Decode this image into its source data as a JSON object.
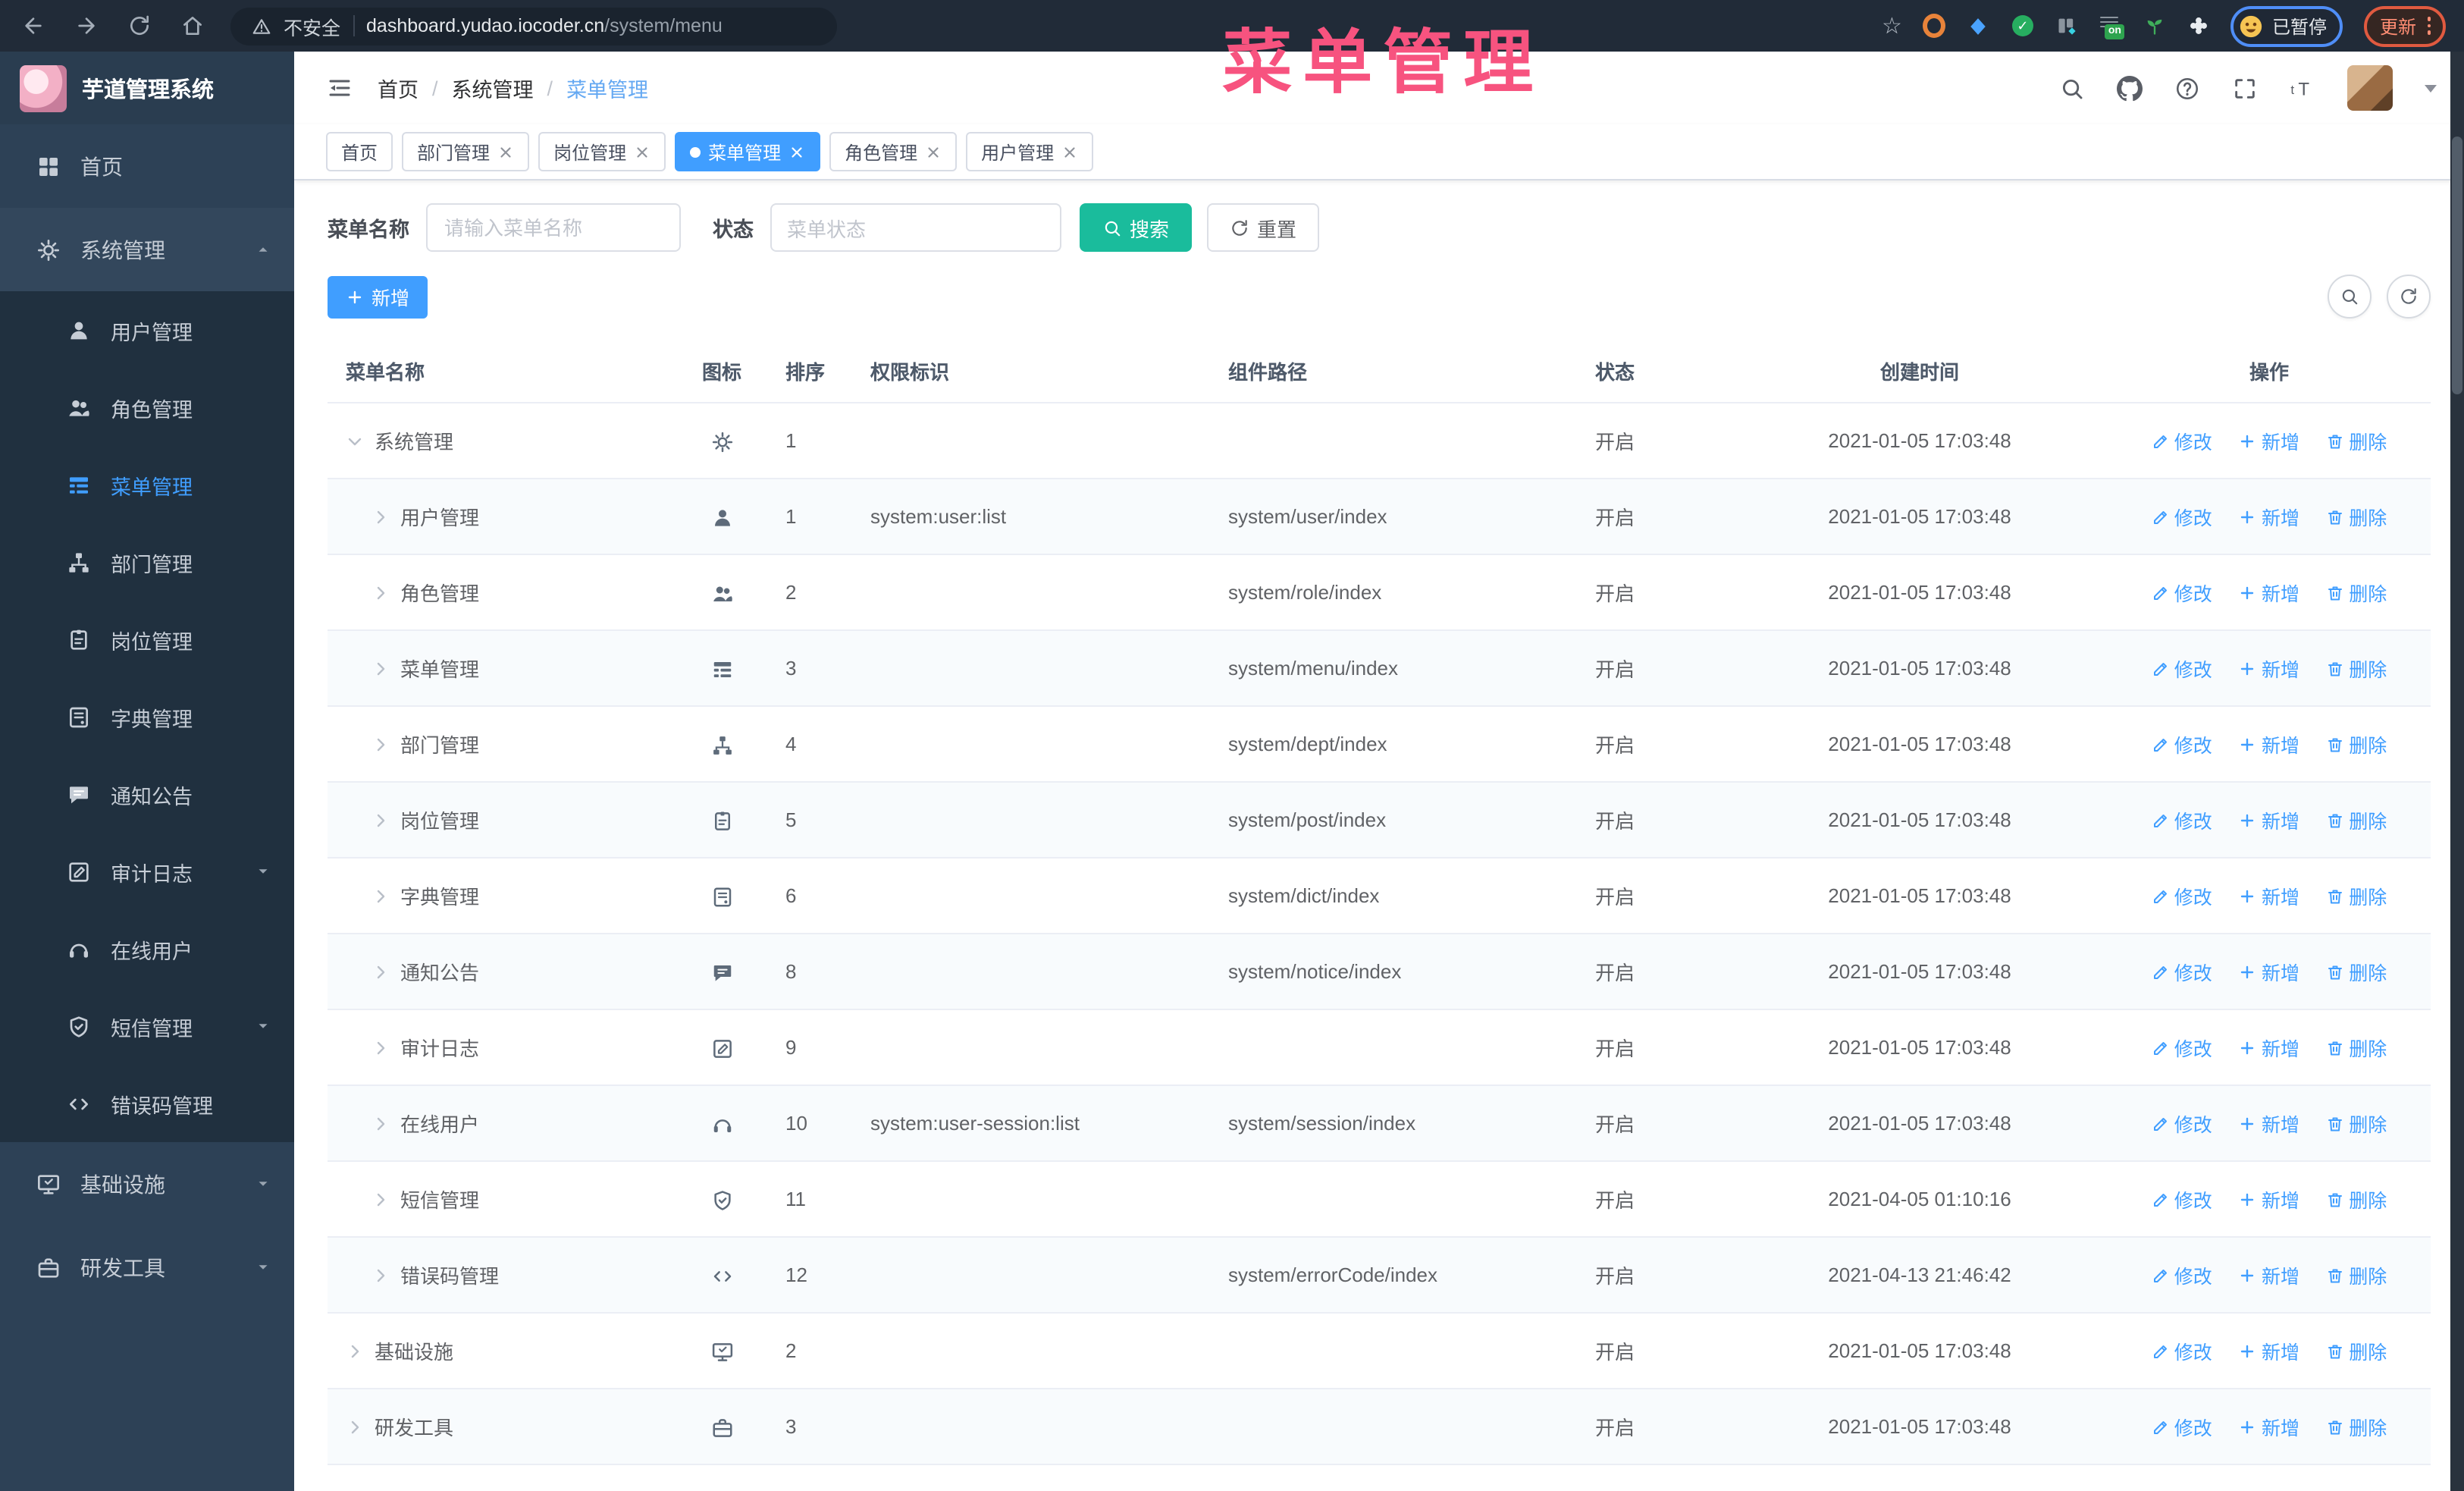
{
  "browser": {
    "security_label": "不安全",
    "url_host": "dashboard.yudao.iocoder.cn",
    "url_path": "/system/menu",
    "ext_on": "on",
    "paused_label": "已暂停",
    "update_label": "更新"
  },
  "overlay_title": "菜单管理",
  "sidebar": {
    "app_title": "芋道管理系统",
    "items": [
      {
        "label": "首页",
        "icon": "dashboard"
      },
      {
        "label": "系统管理",
        "icon": "gear",
        "expanded": true,
        "children": [
          {
            "label": "用户管理",
            "icon": "user"
          },
          {
            "label": "角色管理",
            "icon": "users"
          },
          {
            "label": "菜单管理",
            "icon": "menu",
            "active": true
          },
          {
            "label": "部门管理",
            "icon": "tree"
          },
          {
            "label": "岗位管理",
            "icon": "badge"
          },
          {
            "label": "字典管理",
            "icon": "book"
          },
          {
            "label": "通知公告",
            "icon": "chat"
          },
          {
            "label": "审计日志",
            "icon": "editlog",
            "arrow": "down"
          },
          {
            "label": "在线用户",
            "icon": "headset"
          },
          {
            "label": "短信管理",
            "icon": "shield",
            "arrow": "down"
          },
          {
            "label": "错误码管理",
            "icon": "code"
          }
        ]
      },
      {
        "label": "基础设施",
        "icon": "monitor",
        "arrow": "down"
      },
      {
        "label": "研发工具",
        "icon": "toolbox",
        "arrow": "down"
      }
    ]
  },
  "header": {
    "breadcrumb": [
      "首页",
      "系统管理",
      "菜单管理"
    ]
  },
  "tags": [
    {
      "label": "首页",
      "closable": false,
      "active": false
    },
    {
      "label": "部门管理",
      "closable": true,
      "active": false
    },
    {
      "label": "岗位管理",
      "closable": true,
      "active": false
    },
    {
      "label": "菜单管理",
      "closable": true,
      "active": true
    },
    {
      "label": "角色管理",
      "closable": true,
      "active": false
    },
    {
      "label": "用户管理",
      "closable": true,
      "active": false
    }
  ],
  "filters": {
    "name_label": "菜单名称",
    "name_placeholder": "请输入菜单名称",
    "status_label": "状态",
    "status_placeholder": "菜单状态",
    "search_label": "搜索",
    "reset_label": "重置"
  },
  "toolbar": {
    "add_label": "新增"
  },
  "table": {
    "columns": [
      "菜单名称",
      "图标",
      "排序",
      "权限标识",
      "组件路径",
      "状态",
      "创建时间",
      "操作"
    ],
    "actions": {
      "edit": "修改",
      "add": "新增",
      "del": "删除"
    },
    "rows": [
      {
        "name": "系统管理",
        "icon": "gear",
        "level": 0,
        "caret": "down",
        "sort": "1",
        "perm": "",
        "path": "",
        "status": "开启",
        "time": "2021-01-05 17:03:48"
      },
      {
        "name": "用户管理",
        "icon": "user",
        "level": 1,
        "caret": "right",
        "sort": "1",
        "perm": "system:user:list",
        "path": "system/user/index",
        "status": "开启",
        "time": "2021-01-05 17:03:48"
      },
      {
        "name": "角色管理",
        "icon": "users",
        "level": 1,
        "caret": "right",
        "sort": "2",
        "perm": "",
        "path": "system/role/index",
        "status": "开启",
        "time": "2021-01-05 17:03:48"
      },
      {
        "name": "菜单管理",
        "icon": "menu",
        "level": 1,
        "caret": "right",
        "sort": "3",
        "perm": "",
        "path": "system/menu/index",
        "status": "开启",
        "time": "2021-01-05 17:03:48"
      },
      {
        "name": "部门管理",
        "icon": "tree",
        "level": 1,
        "caret": "right",
        "sort": "4",
        "perm": "",
        "path": "system/dept/index",
        "status": "开启",
        "time": "2021-01-05 17:03:48"
      },
      {
        "name": "岗位管理",
        "icon": "badge",
        "level": 1,
        "caret": "right",
        "sort": "5",
        "perm": "",
        "path": "system/post/index",
        "status": "开启",
        "time": "2021-01-05 17:03:48"
      },
      {
        "name": "字典管理",
        "icon": "book",
        "level": 1,
        "caret": "right",
        "sort": "6",
        "perm": "",
        "path": "system/dict/index",
        "status": "开启",
        "time": "2021-01-05 17:03:48"
      },
      {
        "name": "通知公告",
        "icon": "chat",
        "level": 1,
        "caret": "right",
        "sort": "8",
        "perm": "",
        "path": "system/notice/index",
        "status": "开启",
        "time": "2021-01-05 17:03:48"
      },
      {
        "name": "审计日志",
        "icon": "editlog",
        "level": 1,
        "caret": "right",
        "sort": "9",
        "perm": "",
        "path": "",
        "status": "开启",
        "time": "2021-01-05 17:03:48"
      },
      {
        "name": "在线用户",
        "icon": "headset",
        "level": 1,
        "caret": "right",
        "sort": "10",
        "perm": "system:user-session:list",
        "path": "system/session/index",
        "status": "开启",
        "time": "2021-01-05 17:03:48"
      },
      {
        "name": "短信管理",
        "icon": "shield",
        "level": 1,
        "caret": "right",
        "sort": "11",
        "perm": "",
        "path": "",
        "status": "开启",
        "time": "2021-04-05 01:10:16"
      },
      {
        "name": "错误码管理",
        "icon": "code",
        "level": 1,
        "caret": "right",
        "sort": "12",
        "perm": "",
        "path": "system/errorCode/index",
        "status": "开启",
        "time": "2021-04-13 21:46:42"
      },
      {
        "name": "基础设施",
        "icon": "monitor",
        "level": 0,
        "caret": "right",
        "sort": "2",
        "perm": "",
        "path": "",
        "status": "开启",
        "time": "2021-01-05 17:03:48"
      },
      {
        "name": "研发工具",
        "icon": "toolbox",
        "level": 0,
        "caret": "right",
        "sort": "3",
        "perm": "",
        "path": "",
        "status": "开启",
        "time": "2021-01-05 17:03:48"
      }
    ]
  },
  "colors": {
    "accent": "#409eff",
    "search_button": "#1abc9c",
    "overlay_pink": "#f7537f",
    "sidebar_bg": "#2d4156",
    "sidebar_sub_bg": "#20303f"
  }
}
